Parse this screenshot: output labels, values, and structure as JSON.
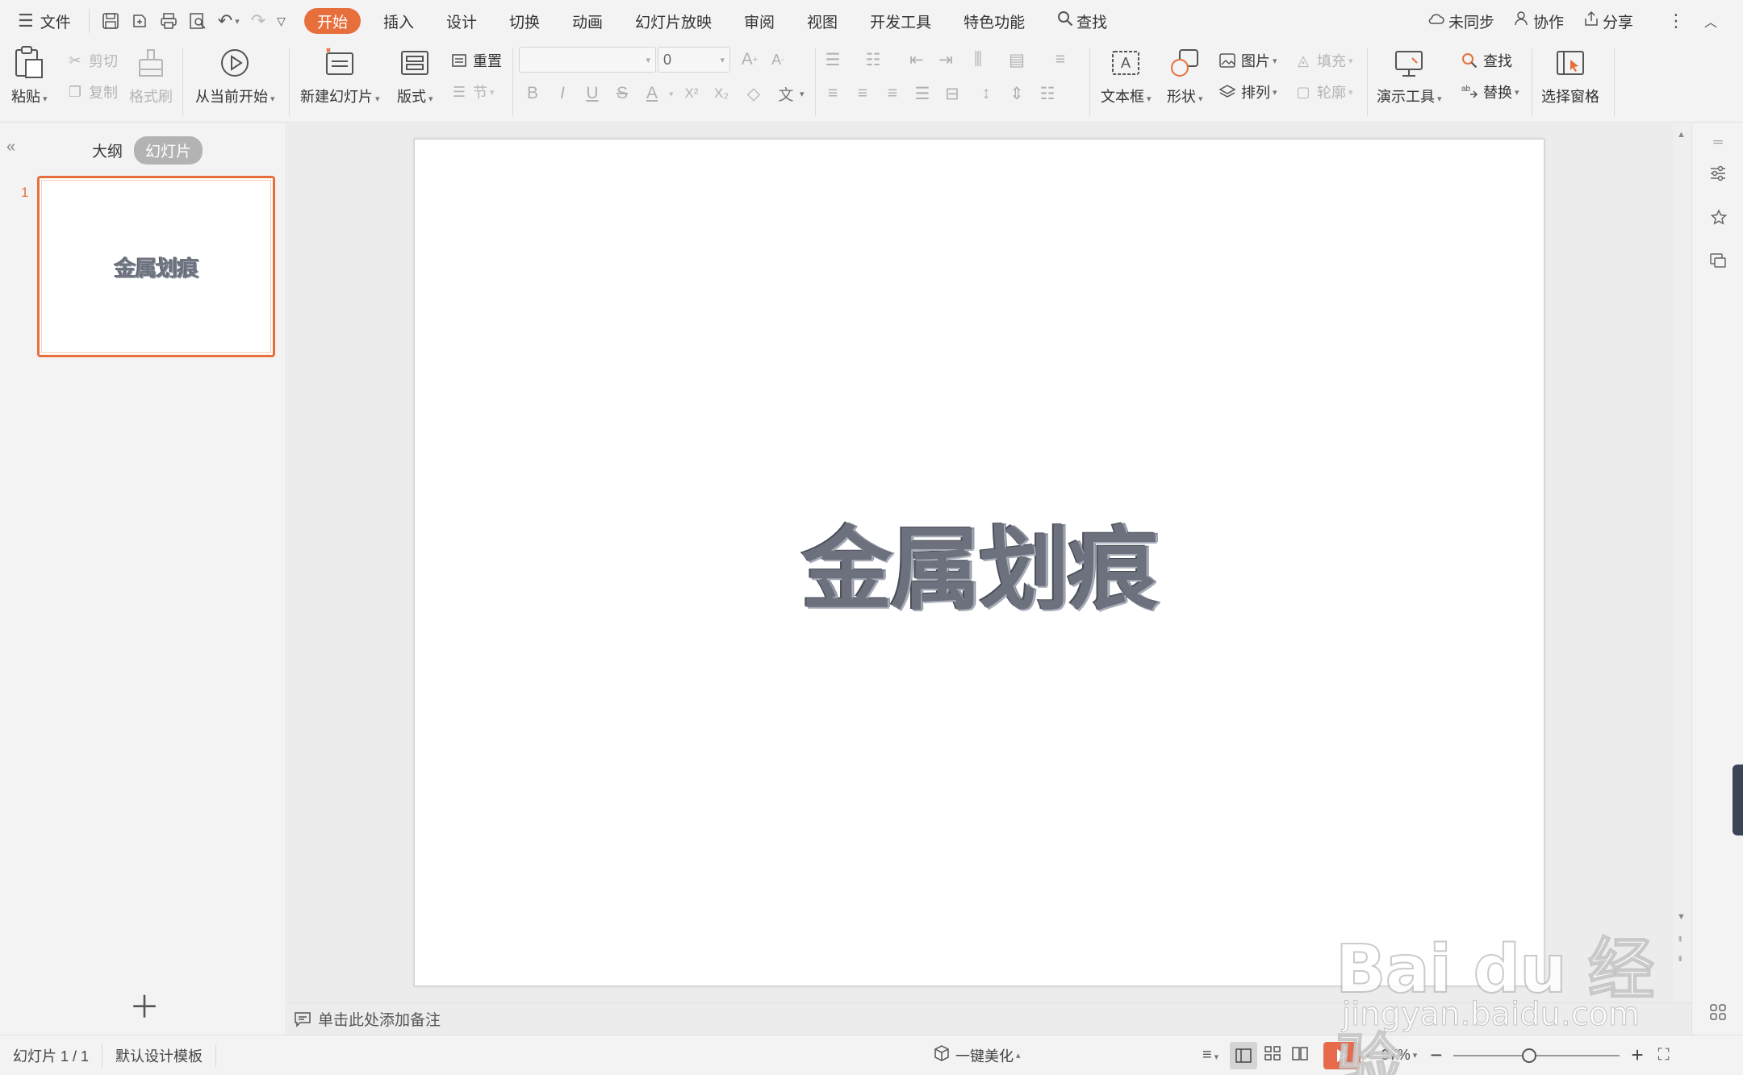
{
  "menubar": {
    "file_label": "文件",
    "tabs": [
      {
        "label": "开始",
        "active": true
      },
      {
        "label": "插入"
      },
      {
        "label": "设计"
      },
      {
        "label": "切换"
      },
      {
        "label": "动画"
      },
      {
        "label": "幻灯片放映"
      },
      {
        "label": "审阅"
      },
      {
        "label": "视图"
      },
      {
        "label": "开发工具"
      },
      {
        "label": "特色功能"
      }
    ],
    "search_label": "查找",
    "sync_label": "未同步",
    "collab_label": "协作",
    "share_label": "分享",
    "accent_color": "#e66f3c"
  },
  "ribbon": {
    "paste": "粘贴",
    "cut": "剪切",
    "copy": "复制",
    "format_painter": "格式刷",
    "from_current": "从当前开始",
    "new_slide": "新建幻灯片",
    "layout": "版式",
    "reset": "重置",
    "section": "节",
    "font_name": "",
    "font_size": "0",
    "text_box": "文本框",
    "shape": "形状",
    "picture": "图片",
    "fill": "填充",
    "arrange": "排列",
    "outline": "轮廓",
    "present_tools": "演示工具",
    "find": "查找",
    "replace": "替换",
    "select_pane": "选择窗格",
    "format_buttons": [
      "B",
      "I",
      "U",
      "S",
      "A",
      "X²",
      "X₂"
    ]
  },
  "leftpanel": {
    "tab_outline": "大纲",
    "tab_slides": "幻灯片",
    "slide_number": "1",
    "thumb_text": "金属划痕"
  },
  "slide": {
    "title": "金属划痕"
  },
  "notes": {
    "placeholder": "单击此处添加备注"
  },
  "statusbar": {
    "slide_indicator": "幻灯片 1 / 1",
    "template": "默认设计模板",
    "beautify": "一键美化",
    "zoom": "97%",
    "zoom_level": 0.45
  },
  "watermark": {
    "logo": "Bai du 经验",
    "url": "jingyan.baidu.com"
  }
}
